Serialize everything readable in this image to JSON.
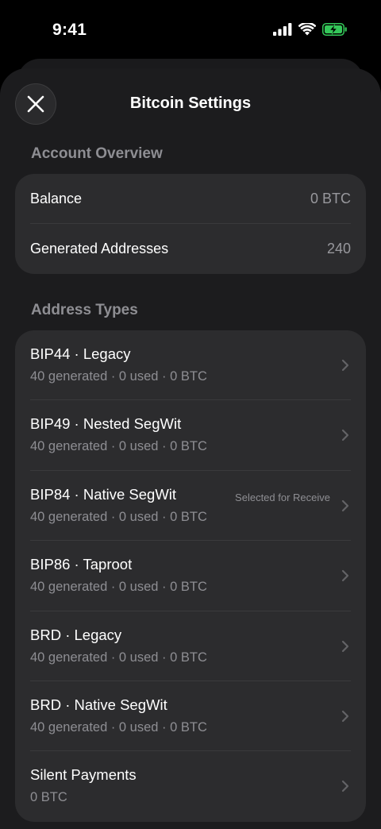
{
  "status": {
    "time": "9:41"
  },
  "header": {
    "title": "Bitcoin Settings"
  },
  "account_overview": {
    "header": "Account Overview",
    "rows": [
      {
        "label": "Balance",
        "value": "0 BTC"
      },
      {
        "label": "Generated Addresses",
        "value": "240"
      }
    ]
  },
  "address_types": {
    "header": "Address Types",
    "items": [
      {
        "name": "BIP44 · Legacy",
        "detail": "40 generated · 0 used · 0 BTC",
        "badge": ""
      },
      {
        "name": "BIP49 · Nested SegWit",
        "detail": "40 generated · 0 used · 0 BTC",
        "badge": ""
      },
      {
        "name": "BIP84 · Native SegWit",
        "detail": "40 generated · 0 used · 0 BTC",
        "badge": "Selected for Receive"
      },
      {
        "name": "BIP86 · Taproot",
        "detail": "40 generated · 0 used · 0 BTC",
        "badge": ""
      },
      {
        "name": "BRD · Legacy",
        "detail": "40 generated · 0 used · 0 BTC",
        "badge": ""
      },
      {
        "name": "BRD · Native SegWit",
        "detail": "40 generated · 0 used · 0 BTC",
        "badge": ""
      },
      {
        "name": "Silent Payments",
        "detail": "0 BTC",
        "badge": ""
      }
    ]
  },
  "colors": {
    "background": "#000000",
    "sheet": "#1c1c1e",
    "card": "#2c2c2e",
    "secondary_text": "#8e8e93",
    "battery": "#34c759"
  },
  "icons": {
    "close": "close-icon",
    "chevron": "chevron-right-icon",
    "signal": "cellular-signal-icon",
    "wifi": "wifi-icon",
    "battery": "battery-charging-icon"
  }
}
